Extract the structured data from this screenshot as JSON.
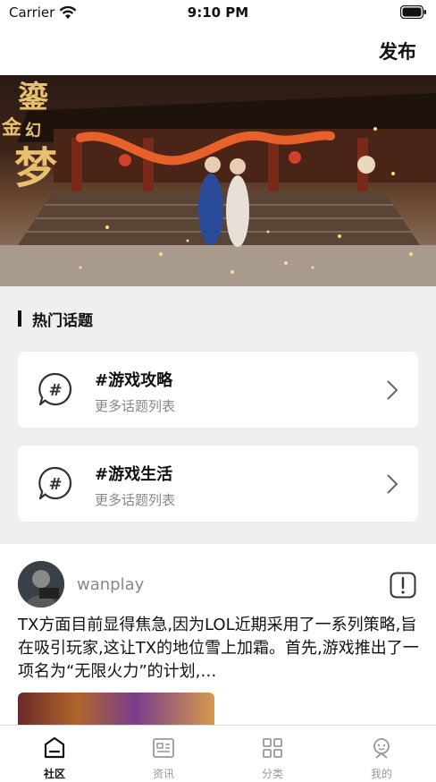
{
  "status_bar": {
    "carrier": "Carrier",
    "time": "9:10 PM"
  },
  "header": {
    "publish_label": "发布"
  },
  "banner": {
    "title_text": "鎏金幻梦",
    "icon": "game-banner-image"
  },
  "hot_topics": {
    "section_title": "热门话题",
    "items": [
      {
        "title": "#游戏攻略",
        "subtitle": "更多话题列表",
        "icon": "topic-hash-icon"
      },
      {
        "title": "#游戏生活",
        "subtitle": "更多话题列表",
        "icon": "topic-hash-icon"
      }
    ]
  },
  "post": {
    "username": "wanplay",
    "text": "TX方面目前显得焦急,因为LOL近期采用了一系列策略,旨在吸引玩家,这让TX的地位雪上加霜。首先,游戏推出了一项名为“无限火力”的计划,…",
    "report_icon": "report-icon"
  },
  "tabbar": {
    "items": [
      {
        "label": "社区",
        "icon": "community-icon",
        "active": true
      },
      {
        "label": "资讯",
        "icon": "news-icon",
        "active": false
      },
      {
        "label": "分类",
        "icon": "category-icon",
        "active": false
      },
      {
        "label": "我的",
        "icon": "profile-icon",
        "active": false
      }
    ]
  },
  "colors": {
    "accent": "#111111",
    "background_gray": "#efefef",
    "muted_text": "#888888"
  }
}
